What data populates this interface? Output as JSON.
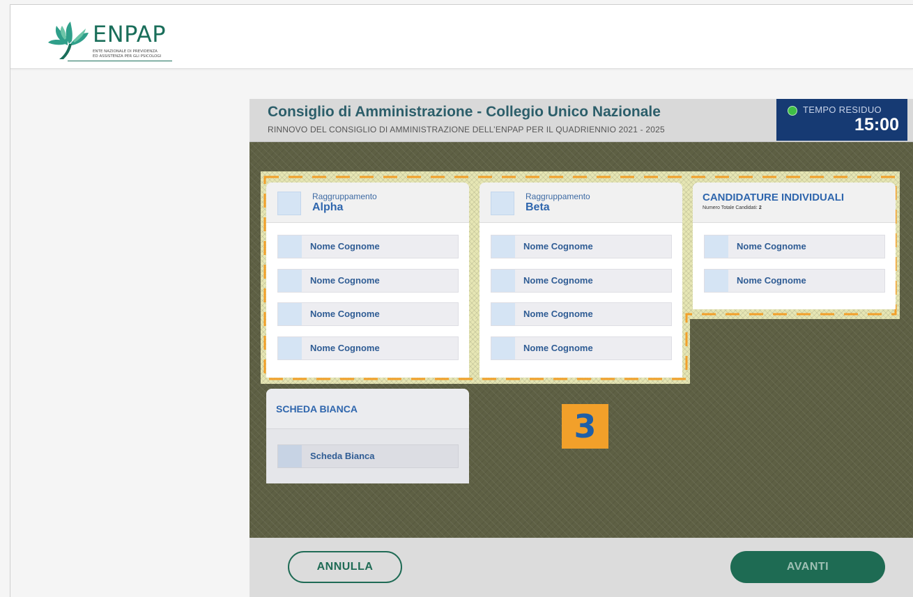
{
  "brand": {
    "logo_text": "ENPAP",
    "logo_sub_line1": "ENTE NAZIONALE DI PREVIDENZA",
    "logo_sub_line2": "ED ASSISTENZA PER GLI PSICOLOGI",
    "logo_icon": "tree-logo-icon",
    "color": "#1a6e5a"
  },
  "ballot": {
    "title": "Consiglio di Amministrazione - Collegio Unico Nazionale",
    "subtitle": "RINNOVO DEL CONSIGLIO DI AMMINISTRAZIONE DELL’ENPAP PER IL QUADRIENNIO  2021 - 2025",
    "timer": {
      "label": "TEMPO RESIDUO",
      "value": "15:00",
      "status_color": "#3fbf46"
    },
    "groups": [
      {
        "prefix": "Raggruppamento",
        "name": "Alpha",
        "candidates": [
          "Nome Cognome",
          "Nome Cognome",
          "Nome Cognome",
          "Nome Cognome"
        ]
      },
      {
        "prefix": "Raggruppamento",
        "name": "Beta",
        "candidates": [
          "Nome Cognome",
          "Nome Cognome",
          "Nome Cognome",
          "Nome Cognome"
        ]
      }
    ],
    "individual": {
      "title": "CANDIDATURE INDIVIDUALI",
      "count_label": "Numero Totale Candidati:",
      "count_value": "2",
      "candidates": [
        "Nome Cognome",
        "Nome Cognome"
      ]
    },
    "blank": {
      "title": "SCHEDA BIANCA",
      "option": "Scheda Bianca"
    },
    "step_badge": "3",
    "buttons": {
      "cancel": "ANNULLA",
      "next": "AVANTI"
    },
    "colors": {
      "header_bg": "#d9d9d9",
      "timer_bg": "#163a73",
      "highlight_dash": "#f2a02a",
      "primary": "#1e6b53",
      "text_blue": "#2f66ad"
    }
  }
}
